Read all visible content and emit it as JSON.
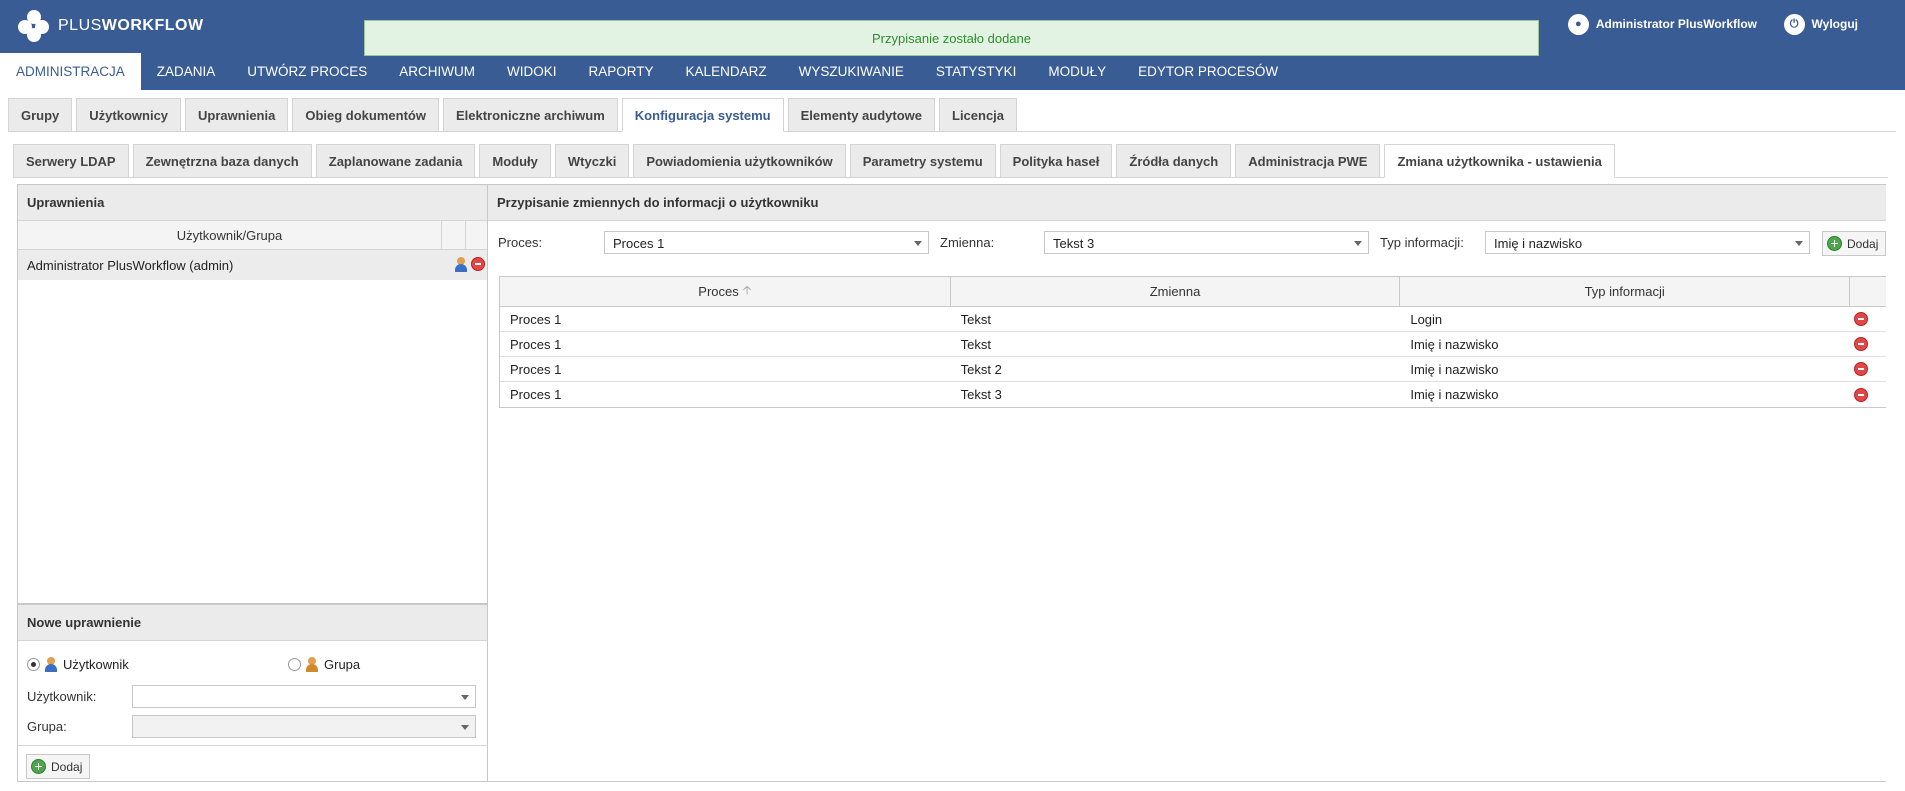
{
  "header": {
    "logo_plus": "PLUS",
    "logo_workflow": "WORKFLOW",
    "notification": "Przypisanie zostało dodane",
    "user_name": "Administrator PlusWorkflow",
    "logout_label": "Wyloguj"
  },
  "main_nav": [
    {
      "label": "ADMINISTRACJA"
    },
    {
      "label": "ZADANIA"
    },
    {
      "label": "UTWÓRZ PROCES"
    },
    {
      "label": "ARCHIWUM"
    },
    {
      "label": "WIDOKI"
    },
    {
      "label": "RAPORTY"
    },
    {
      "label": "KALENDARZ"
    },
    {
      "label": "WYSZUKIWANIE"
    },
    {
      "label": "STATYSTYKI"
    },
    {
      "label": "MODUŁY"
    },
    {
      "label": "EDYTOR PROCESÓW"
    }
  ],
  "tabs_level1": [
    {
      "label": "Grupy"
    },
    {
      "label": "Użytkownicy"
    },
    {
      "label": "Uprawnienia"
    },
    {
      "label": "Obieg dokumentów"
    },
    {
      "label": "Elektroniczne archiwum"
    },
    {
      "label": "Konfiguracja systemu"
    },
    {
      "label": "Elementy audytowe"
    },
    {
      "label": "Licencja"
    }
  ],
  "tabs_level2": [
    {
      "label": "Serwery LDAP"
    },
    {
      "label": "Zewnętrzna baza danych"
    },
    {
      "label": "Zaplanowane zadania"
    },
    {
      "label": "Moduły"
    },
    {
      "label": "Wtyczki"
    },
    {
      "label": "Powiadomienia użytkowników"
    },
    {
      "label": "Parametry systemu"
    },
    {
      "label": "Polityka haseł"
    },
    {
      "label": "Źródła danych"
    },
    {
      "label": "Administracja PWE"
    },
    {
      "label": "Zmiana użytkownika - ustawienia"
    }
  ],
  "permissions_panel": {
    "title": "Uprawnienia",
    "column_user_group": "Użytkownik/Grupa",
    "rows": [
      {
        "name": "Administrator PlusWorkflow (admin)"
      }
    ]
  },
  "new_permission": {
    "title": "Nowe uprawnienie",
    "radio_user": "Użytkownik",
    "radio_group": "Grupa",
    "user_label": "Użytkownik:",
    "group_label": "Grupa:",
    "user_value": "",
    "group_value": "",
    "add_label": "Dodaj"
  },
  "assignment_panel": {
    "title": "Przypisanie zmiennych do informacji o użytkowniku",
    "process_label": "Proces:",
    "process_value": "Proces 1",
    "variable_label": "Zmienna:",
    "variable_value": "Tekst 3",
    "info_type_label": "Typ informacji:",
    "info_type_value": "Imię i nazwisko",
    "add_label": "Dodaj",
    "columns": [
      "Proces",
      "Zmienna",
      "Typ informacji"
    ],
    "rows": [
      {
        "process": "Proces 1",
        "variable": "Tekst",
        "info_type": "Login"
      },
      {
        "process": "Proces 1",
        "variable": "Tekst",
        "info_type": "Imię i nazwisko"
      },
      {
        "process": "Proces 1",
        "variable": "Tekst 2",
        "info_type": "Imię i nazwisko"
      },
      {
        "process": "Proces 1",
        "variable": "Tekst 3",
        "info_type": "Imię i nazwisko"
      }
    ]
  }
}
